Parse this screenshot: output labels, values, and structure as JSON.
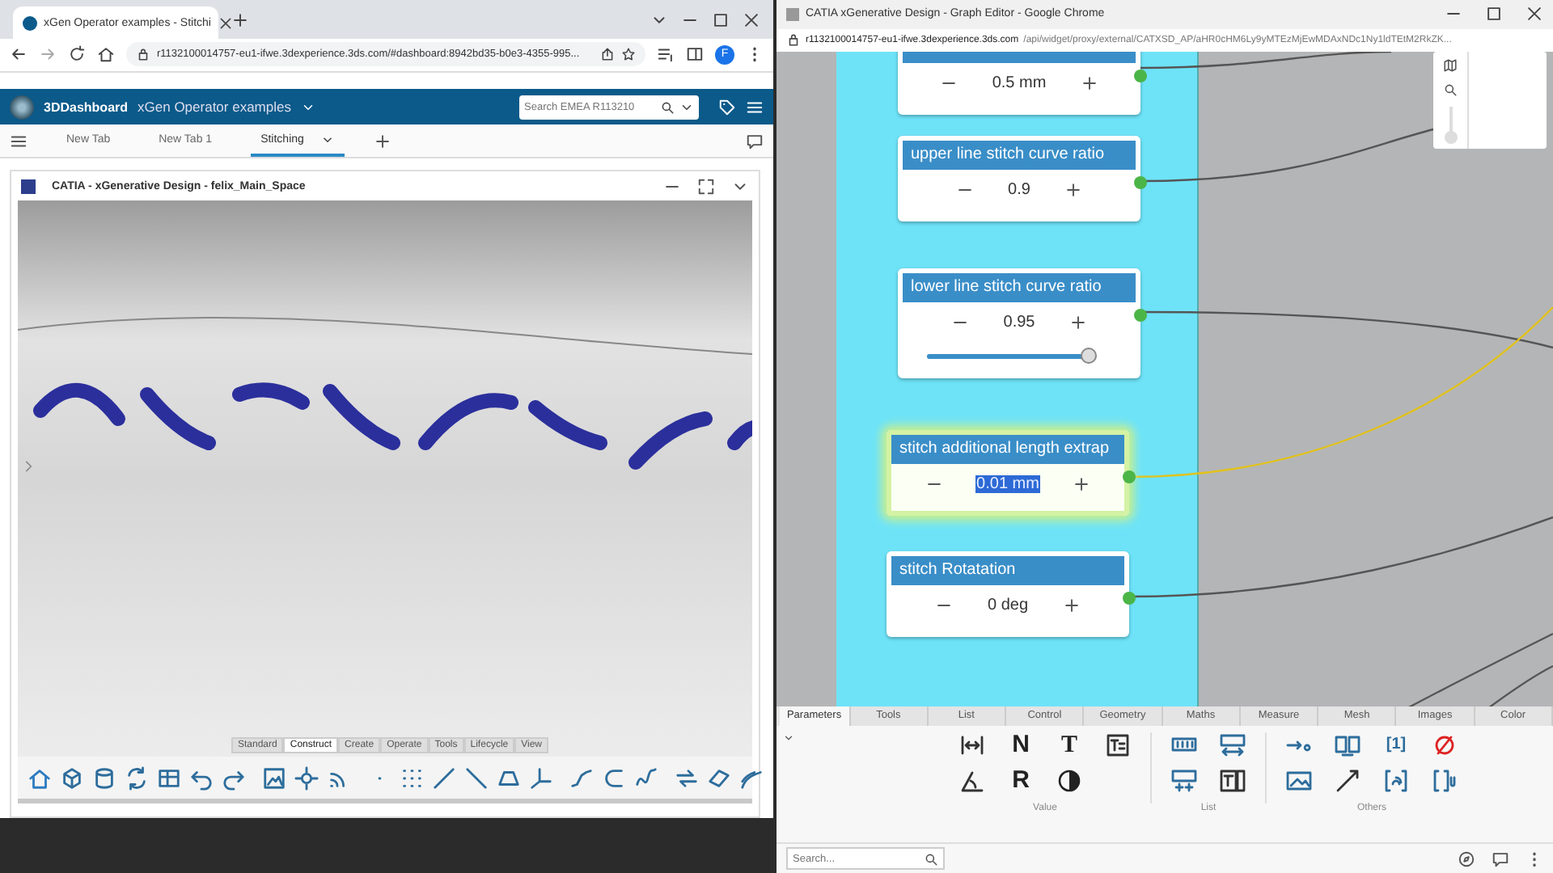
{
  "left_browser": {
    "tab_title": "xGen Operator examples - Stitchi",
    "url": "r1132100014757-eu1-ifwe.3dexperience.3ds.com/#dashboard:8942bd35-b0e3-4355-995...",
    "profile": "F"
  },
  "dashboard": {
    "brand": "3DDashboard",
    "title": "xGen Operator examples",
    "search": {
      "placeholder": "Search EMEA R113210"
    },
    "tabs": [
      {
        "label": "New Tab",
        "selected": false
      },
      {
        "label": "New Tab 1",
        "selected": false
      },
      {
        "label": "Stitching",
        "selected": true
      }
    ]
  },
  "widget": {
    "title": "CATIA - xGenerative Design - felix_Main_Space",
    "toolbar_tabs": [
      {
        "label": "Standard",
        "selected": false
      },
      {
        "label": "Construct",
        "selected": true
      },
      {
        "label": "Create",
        "selected": false
      },
      {
        "label": "Operate",
        "selected": false
      },
      {
        "label": "Tools",
        "selected": false
      },
      {
        "label": "Lifecycle",
        "selected": false
      },
      {
        "label": "View",
        "selected": false
      }
    ]
  },
  "right_window": {
    "title": "CATIA xGenerative Design - Graph Editor - Google Chrome",
    "url_host": "r1132100014757-eu1-ifwe.3dexperience.3ds.com",
    "url_path": "/api/widget/proxy/external/CATXSD_AP/aHR0cHM6Ly9yMTEzMjEwMDAxNDc1Ny1ldTEtM2RkZK..."
  },
  "graph": {
    "zoom": {
      "level": 0.05
    },
    "nodes": [
      {
        "kind": "value",
        "value": "0.5 mm",
        "selected": false,
        "value_selected": false
      },
      {
        "kind": "value",
        "title": "upper line stitch curve ratio",
        "value": "0.9",
        "selected": false,
        "value_selected": false
      },
      {
        "kind": "slider",
        "title": "lower line stitch curve ratio",
        "value": "0.95",
        "level": 0.95,
        "selected": false,
        "value_selected": false
      },
      {
        "kind": "value",
        "title": "stitch additional length extrap",
        "value": "0.01 mm",
        "selected": true,
        "value_selected": true
      },
      {
        "kind": "value",
        "title": "stitch Rotatation",
        "value": "0 deg",
        "selected": false,
        "value_selected": false
      }
    ]
  },
  "palette": {
    "tabs": [
      {
        "label": "Parameters",
        "selected": true
      },
      {
        "label": "Tools",
        "selected": false
      },
      {
        "label": "List",
        "selected": false
      },
      {
        "label": "Control",
        "selected": false
      },
      {
        "label": "Geometry",
        "selected": false
      },
      {
        "label": "Maths",
        "selected": false
      },
      {
        "label": "Measure",
        "selected": false
      },
      {
        "label": "Mesh",
        "selected": false
      },
      {
        "label": "Images",
        "selected": false
      },
      {
        "label": "Color",
        "selected": false
      }
    ],
    "value_glyphs": [
      "N",
      "T",
      "R"
    ],
    "others_glyph": "[1]",
    "groups": [
      "Value",
      "List",
      "Others"
    ],
    "search": {
      "placeholder": "Search..."
    }
  }
}
